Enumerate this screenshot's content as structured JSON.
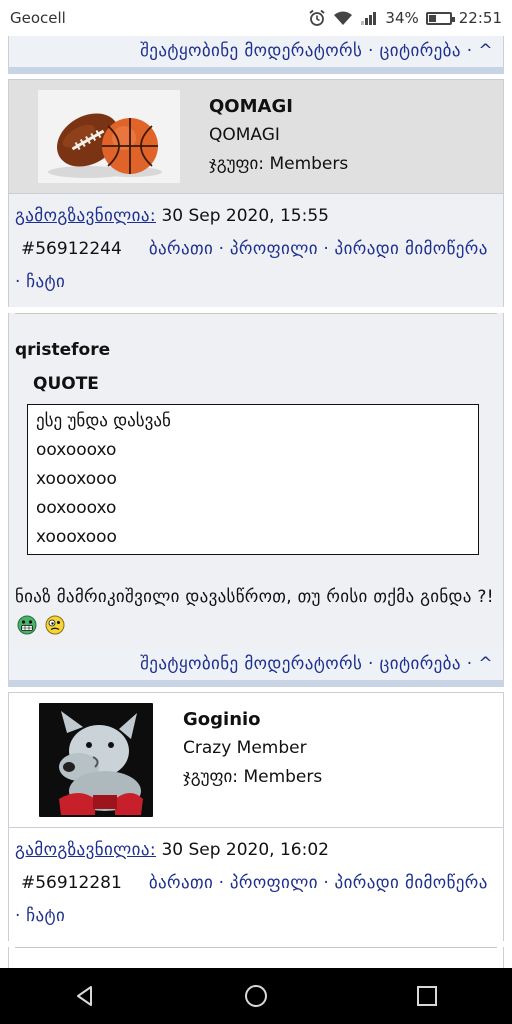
{
  "status_bar": {
    "carrier": "Geocell",
    "battery": "34%",
    "battery_level": 0.34,
    "time": "22:51",
    "icons": [
      "alarm-icon",
      "wifi-icon",
      "signal-icon",
      "battery-icon"
    ]
  },
  "post_actions": {
    "report": "შეატყობინე მოდერატორს",
    "separator": "·",
    "quote": "ციტირება",
    "top": "^"
  },
  "posts": [
    {
      "author": {
        "name": "QOMAGI",
        "title": "QOMAGI",
        "group": "ჯგუფი: Members",
        "avatar": "balls-avatar"
      },
      "meta": {
        "posted_label": "გამოგზავნილია:",
        "date": "30 Sep 2020, 15:55",
        "post_id": "#56912244",
        "card": "ბარათი",
        "profile": "პროფილი",
        "pm": "პირადი მიმოწერა",
        "chat": "ჩატი"
      },
      "body": {
        "quoted_author": "qristefore",
        "quote_title": "QUOTE",
        "quote_lines": [
          "ესე უნდა დასვან",
          "ooxoooxo",
          "xoooxooo",
          "ooxoooxo",
          "xoooxooo"
        ],
        "text": "ნიაზ მამრიკიშვილი დავასწროთ, თუ რისი თქმა გინდა ?!",
        "emojis": [
          "grin-emoji",
          "confused-emoji"
        ]
      }
    },
    {
      "author": {
        "name": "Goginio",
        "title": "Crazy Member",
        "group": "ჯგუფი: Members",
        "avatar": "dog-avatar"
      },
      "meta": {
        "posted_label": "გამოგზავნილია:",
        "date": "30 Sep 2020, 16:02",
        "post_id": "#56912281",
        "card": "ბარათი",
        "profile": "პროფილი",
        "pm": "პირადი მიმოწერა",
        "chat": "ჩატი"
      }
    }
  ],
  "nav": {
    "icons": [
      "back-icon",
      "home-icon",
      "recents-icon"
    ]
  }
}
